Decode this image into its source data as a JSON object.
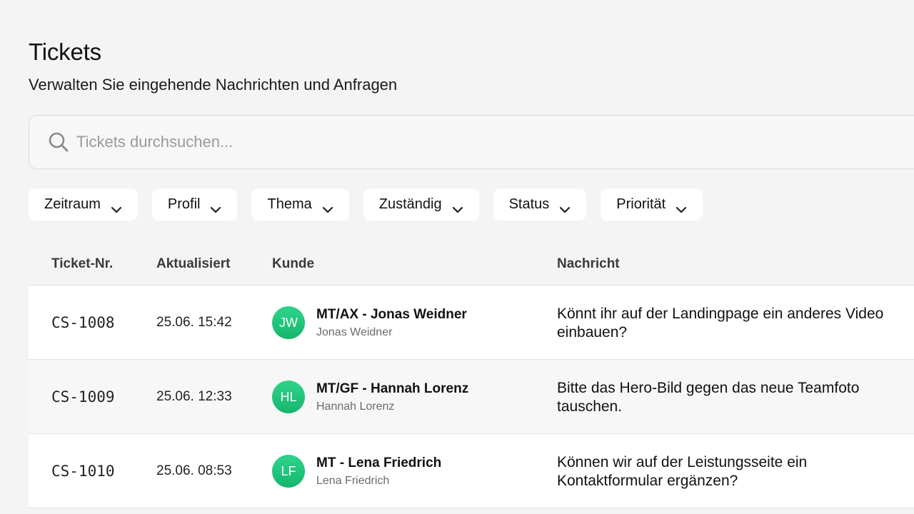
{
  "header": {
    "title": "Tickets",
    "subtitle": "Verwalten Sie eingehende Nachrichten und Anfragen"
  },
  "search": {
    "placeholder": "Tickets durchsuchen...",
    "value": "",
    "icon": "search-icon"
  },
  "filters": [
    {
      "label": "Zeitraum"
    },
    {
      "label": "Profil"
    },
    {
      "label": "Thema"
    },
    {
      "label": "Zuständig"
    },
    {
      "label": "Status"
    },
    {
      "label": "Priorität"
    }
  ],
  "table": {
    "columns": [
      "Ticket-Nr.",
      "Aktualisiert",
      "Kunde",
      "Nachricht"
    ],
    "rows": [
      {
        "id": "CS-1008",
        "updated": "25.06. 15:42",
        "initials": "JW",
        "customer": "MT/AX - Jonas Weidner",
        "contact": "Jonas Weidner",
        "message": "Könnt ihr auf der Landingpage ein anderes Video einbauen?"
      },
      {
        "id": "CS-1009",
        "updated": "25.06. 12:33",
        "initials": "HL",
        "customer": "MT/GF - Hannah Lorenz",
        "contact": "Hannah Lorenz",
        "message": "Bitte das Hero-Bild gegen das neue Teamfoto tauschen."
      },
      {
        "id": "CS-1010",
        "updated": "25.06. 08:53",
        "initials": "LF",
        "customer": "MT - Lena Friedrich",
        "contact": "Lena Friedrich",
        "message": "Können wir auf der Leistungsseite ein Kontaktformular ergänzen?"
      }
    ]
  },
  "colors": {
    "background": "#f4f4f5",
    "avatar": "#1cc47a",
    "text": "#111111",
    "muted": "#6b6b6b"
  }
}
